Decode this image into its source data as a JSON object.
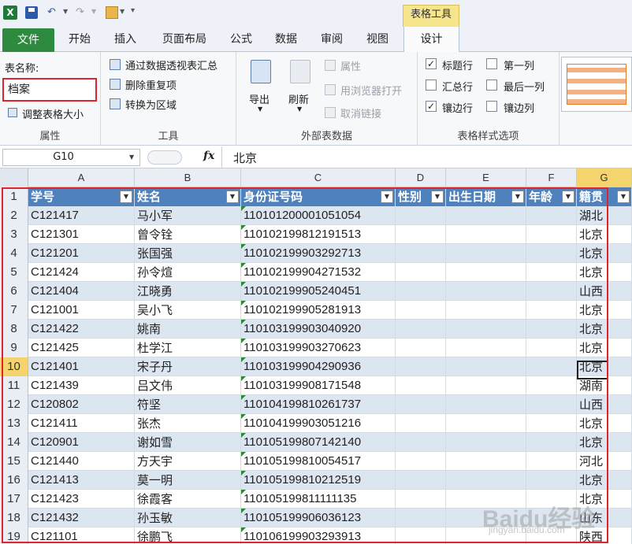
{
  "quick_access": {
    "app_icon": "excel-icon",
    "save_icon": "save-icon",
    "undo_glyph": "↶",
    "redo_glyph": "↷",
    "open_icon": "folder-open-icon",
    "context_group": "表格工具"
  },
  "tabs": [
    "文件",
    "开始",
    "插入",
    "页面布局",
    "公式",
    "数据",
    "审阅",
    "视图",
    "设计"
  ],
  "ribbon": {
    "properties": {
      "name_label": "表名称:",
      "name_value": "档案",
      "resize_label": "调整表格大小",
      "group_label": "属性"
    },
    "tools": {
      "pivot_label": "通过数据透视表汇总",
      "remove_dup_label": "删除重复项",
      "convert_label": "转换为区域",
      "group_label": "工具"
    },
    "external": {
      "export_label": "导出",
      "refresh_label": "刷新",
      "properties_label": "属性",
      "browser_label": "用浏览器打开",
      "unlink_label": "取消链接",
      "group_label": "外部表数据"
    },
    "style_options": {
      "header_row": "标题行",
      "total_row": "汇总行",
      "banded_rows": "镶边行",
      "first_col": "第一列",
      "last_col": "最后一列",
      "banded_cols": "镶边列",
      "group_label": "表格样式选项"
    },
    "accent_color": "#4f81bd"
  },
  "formula_bar": {
    "cell_ref": "G10",
    "fx": "fx",
    "value": "北京"
  },
  "columns": [
    "A",
    "B",
    "C",
    "D",
    "E",
    "F",
    "G"
  ],
  "table": {
    "headers": [
      "学号",
      "姓名",
      "身份证号码",
      "性别",
      "出生日期",
      "年龄",
      "籍贯"
    ],
    "rows": [
      [
        "C121417",
        "马小军",
        "110101200001051054",
        "湖北"
      ],
      [
        "C121301",
        "曾令铨",
        "110102199812191513",
        "北京"
      ],
      [
        "C121201",
        "张国强",
        "110102199903292713",
        "北京"
      ],
      [
        "C121424",
        "孙令煊",
        "110102199904271532",
        "北京"
      ],
      [
        "C121404",
        "江晓勇",
        "110102199905240451",
        "山西"
      ],
      [
        "C121001",
        "吴小飞",
        "110102199905281913",
        "北京"
      ],
      [
        "C121422",
        "姚南",
        "110103199903040920",
        "北京"
      ],
      [
        "C121425",
        "杜学江",
        "110103199903270623",
        "北京"
      ],
      [
        "C121401",
        "宋子丹",
        "110103199904290936",
        "北京"
      ],
      [
        "C121439",
        "吕文伟",
        "110103199908171548",
        "湖南"
      ],
      [
        "C120802",
        "符坚",
        "110104199810261737",
        "山西"
      ],
      [
        "C121411",
        "张杰",
        "110104199903051216",
        "北京"
      ],
      [
        "C120901",
        "谢如雪",
        "110105199807142140",
        "北京"
      ],
      [
        "C121440",
        "方天宇",
        "110105199810054517",
        "河北"
      ],
      [
        "C121413",
        "莫一明",
        "110105199810212519",
        "北京"
      ],
      [
        "C121423",
        "徐霞客",
        "110105199811111135",
        "北京"
      ],
      [
        "C121432",
        "孙玉敏",
        "110105199906036123",
        "山东"
      ],
      [
        "C121101",
        "徐鹏飞",
        "110106199903293913",
        "陕西"
      ]
    ]
  },
  "watermark": {
    "brand": "Baidu经验",
    "url": "jingyan.baidu.com"
  }
}
